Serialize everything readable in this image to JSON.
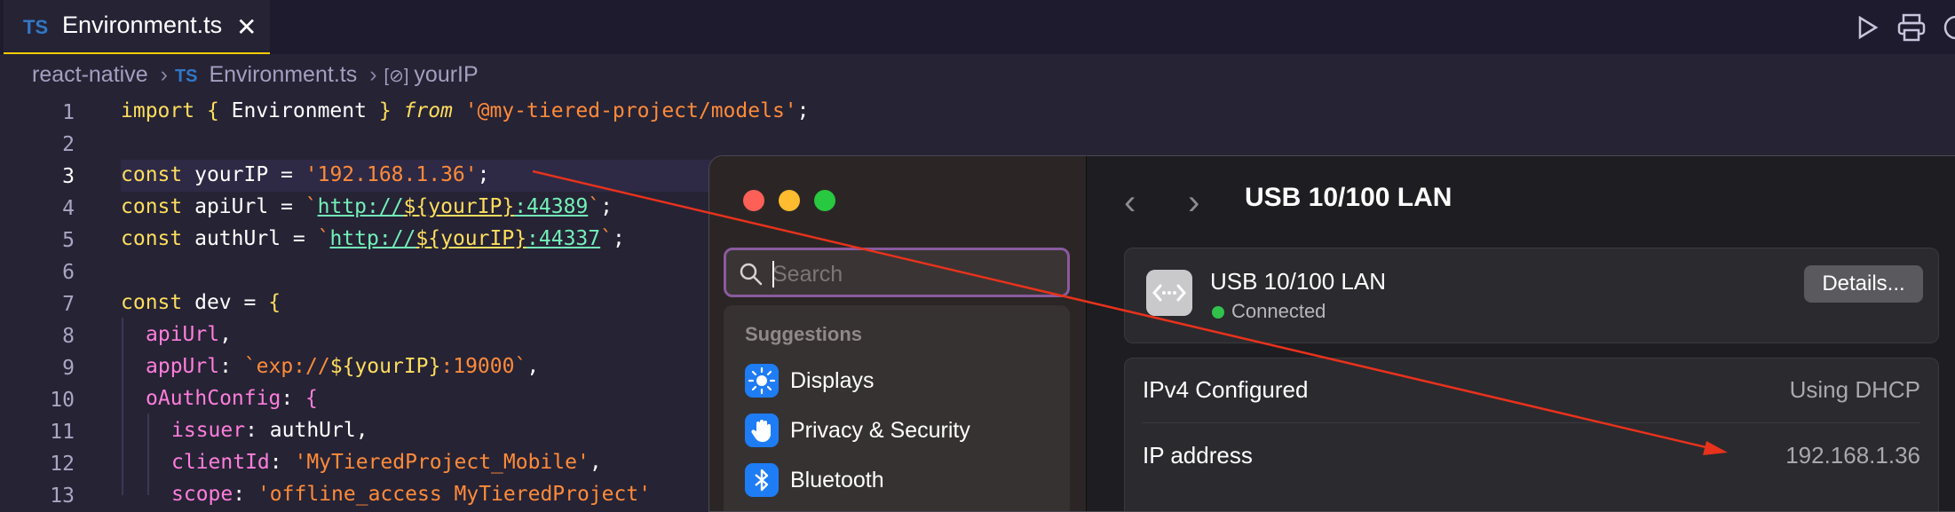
{
  "tab": {
    "lang_badge": "TS",
    "filename": "Environment.ts",
    "close_glyph": "✕"
  },
  "breadcrumb": {
    "folder": "react-native",
    "lang_badge": "TS",
    "file": "Environment.ts",
    "symbol_glyph": "[⊘]",
    "symbol": "yourIP"
  },
  "editor": {
    "line_numbers": [
      "1",
      "2",
      "3",
      "4",
      "5",
      "6",
      "7",
      "8",
      "9",
      "10",
      "11",
      "12",
      "13"
    ],
    "code": {
      "l1": {
        "kw": "import",
        "open": " { ",
        "name": "Environment",
        "close": " } ",
        "from": "from",
        "sp": " ",
        "str": "'@my-tiered-project/models'",
        "semi": ";"
      },
      "l3": {
        "kw": "const",
        "sp": " ",
        "name": "yourIP",
        "eq": " = ",
        "str": "'192.168.1.36'",
        "semi": ";"
      },
      "l4": {
        "kw": "const",
        "sp": " ",
        "name": "apiUrl",
        "eq": " = ",
        "tick": "`",
        "url": "http://",
        "interp_open": "${",
        "var": "yourIP",
        "interp_close": "}",
        "port": ":44389",
        "tick2": "`",
        "semi": ";"
      },
      "l5": {
        "kw": "const",
        "sp": " ",
        "name": "authUrl",
        "eq": " = ",
        "tick": "`",
        "url": "http://",
        "interp_open": "${",
        "var": "yourIP",
        "interp_close": "}",
        "port": ":44337",
        "tick2": "`",
        "semi": ";"
      },
      "l7": {
        "kw": "const",
        "sp": " ",
        "name": "dev",
        "eq": " = ",
        "brace": "{"
      },
      "l8": {
        "prop": "apiUrl",
        "comma": ","
      },
      "l9": {
        "prop": "appUrl",
        "colon": ": ",
        "tick": "`exp://",
        "interp_open": "${",
        "var": "yourIP",
        "interp_close": "}",
        "rest": ":19000`",
        "comma": ","
      },
      "l10": {
        "prop": "oAuthConfig",
        "colon": ": ",
        "brace": "{"
      },
      "l11": {
        "prop": "issuer",
        "colon": ": ",
        "val": "authUrl",
        "comma": ","
      },
      "l12": {
        "prop": "clientId",
        "colon": ": ",
        "str": "'MyTieredProject_Mobile'",
        "comma": ","
      },
      "l13": {
        "prop": "scope",
        "colon": ": ",
        "str": "'offline_access MyTieredProject'"
      }
    }
  },
  "settings": {
    "search_placeholder": "Search",
    "suggestions_header": "Suggestions",
    "suggestions": [
      "Displays",
      "Privacy & Security",
      "Bluetooth"
    ],
    "nav_back": "‹",
    "nav_forward": "›",
    "title": "USB 10/100 LAN",
    "device": {
      "name": "USB 10/100 LAN",
      "status": "Connected",
      "details_button": "Details..."
    },
    "rows": [
      {
        "key": "IPv4 Configured",
        "value": "Using DHCP"
      },
      {
        "key": "IP address",
        "value": "192.168.1.36"
      }
    ]
  },
  "colors": {
    "accent": "#ffcc00",
    "connected": "#30c24b",
    "arrow": "#e8321c",
    "search_focus": "#8a5a9e"
  }
}
